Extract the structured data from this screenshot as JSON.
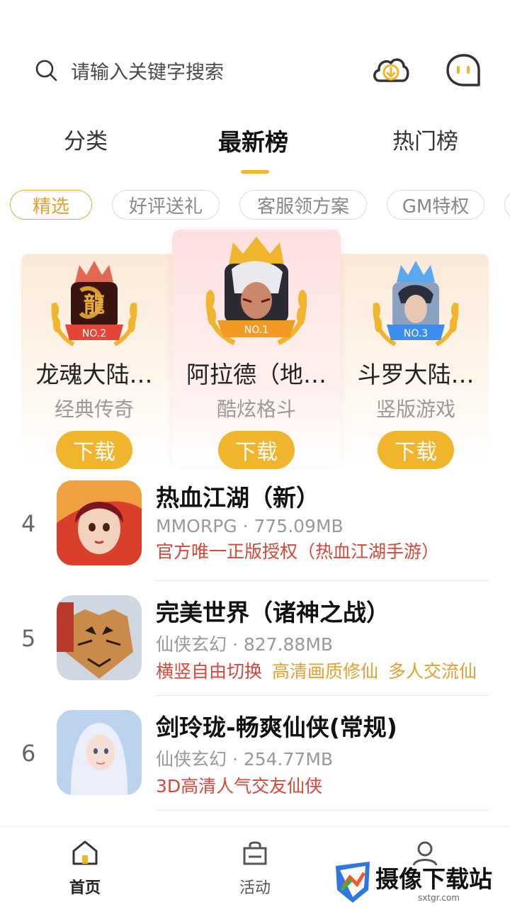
{
  "search": {
    "placeholder": "请输入关键字搜索"
  },
  "header": {
    "download_icon": "cloud-download-icon",
    "message_icon": "chat-icon"
  },
  "tabs": [
    {
      "label": "分类"
    },
    {
      "label": "最新榜",
      "active": true
    },
    {
      "label": "热门榜"
    }
  ],
  "chips": [
    {
      "label": "精选",
      "active": true
    },
    {
      "label": "好评送礼"
    },
    {
      "label": "客服领方案"
    },
    {
      "label": "GM特权"
    }
  ],
  "podium": [
    {
      "rank_badge": "NO.2",
      "name": "龙魂大陆…",
      "genre": "经典传奇",
      "button": "下载",
      "crown_color": "#e26a52",
      "badge_color": "#e6463a"
    },
    {
      "rank_badge": "NO.1",
      "name": "阿拉德（地…",
      "genre": "酷炫格斗",
      "button": "下载",
      "crown_color": "#f0b42d",
      "badge_color": "#f39a26"
    },
    {
      "rank_badge": "NO.3",
      "name": "斗罗大陆…",
      "genre": "竖版游戏",
      "button": "下载",
      "crown_color": "#5aa8f0",
      "badge_color": "#3c8ef0"
    }
  ],
  "list": [
    {
      "rank": "4",
      "title": "热血江湖（新）",
      "meta": "MMORPG   · 775.09MB",
      "tags": [
        {
          "text": "官方唯一正版授权（热血江湖手游）",
          "color": "red"
        }
      ]
    },
    {
      "rank": "5",
      "title": "完美世界（诸神之战）",
      "meta": "仙侠玄幻 · 827.88MB",
      "tags": [
        {
          "text": "横竖自由切换",
          "color": "red"
        },
        {
          "text": "高清画质修仙",
          "color": "gold"
        },
        {
          "text": "多人交流仙",
          "color": "gold"
        }
      ]
    },
    {
      "rank": "6",
      "title": "剑玲珑-畅爽仙侠(常规)",
      "meta": "仙侠玄幻 · 254.77MB",
      "tags": [
        {
          "text": "3D高清人气交友仙侠",
          "color": "red"
        }
      ]
    }
  ],
  "bottom_nav": [
    {
      "label": "首页",
      "active": true
    },
    {
      "label": "活动"
    },
    {
      "label": ""
    }
  ],
  "watermark": {
    "text": "摄像下载站",
    "url": "sxtgr.com"
  }
}
